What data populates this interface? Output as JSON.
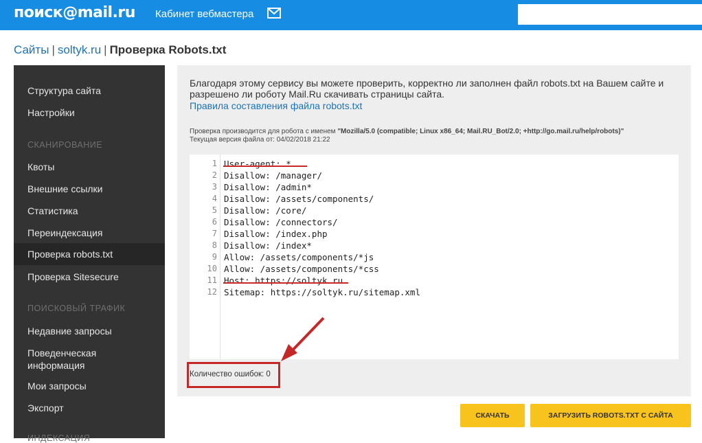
{
  "header": {
    "logo": "поиск@mail.ru",
    "cabinet_label": "Кабинет вебмастера",
    "mail_icon": "envelope-icon",
    "search_placeholder": ""
  },
  "breadcrumb": {
    "sites": "Сайты",
    "domain": "soltyk.ru",
    "current": "Проверка Robots.txt"
  },
  "sidebar": {
    "items_top": [
      "Структура сайта",
      "Настройки"
    ],
    "section_scanning": "СКАНИРОВАНИЕ",
    "items_scanning": [
      "Квоты",
      "Внешние ссылки",
      "Статистика",
      "Переиндексация",
      "Проверка robots.txt",
      "Проверка Sitesecure"
    ],
    "active_item": "Проверка robots.txt",
    "section_traffic": "ПОИСКОВЫЙ ТРАФИК",
    "items_traffic": [
      "Недавние запросы",
      "Поведенческая информация",
      "Мои запросы",
      "Экспорт"
    ],
    "section_cut": "ИНДЕКСАЦИЯ"
  },
  "main": {
    "intro": "Благодаря этому сервису вы можете проверить, корректно ли заполнен файл robots.txt на Вашем сайте и разрешено ли роботу Mail.Ru скачивать страницы сайта.",
    "rules_link": "Правила составления файла robots.txt",
    "check_prefix": "Проверка производится для робота с именем ",
    "robot_name": "\"Mozilla/5.0 (compatible; Linux x86_64; Mail.RU_Bot/2.0; +http://go.mail.ru/help/robots)\"",
    "version_label": "Текущая версия файла от: 04/02/2018 21:22",
    "code_lines": [
      "User-agent: *",
      "Disallow: /manager/",
      "Disallow: /admin*",
      "Disallow: /assets/components/",
      "Disallow: /core/",
      "Disallow: /connectors/",
      "Disallow: /index.php",
      "Disallow: /index*",
      "Allow: /assets/components/*js",
      "Allow: /assets/components/*css",
      "Host: https://soltyk.ru",
      "Sitemap: https://soltyk.ru/sitemap.xml"
    ],
    "errors_label": "Количество ошибок: 0"
  },
  "buttons": {
    "check": "СКАЧАТЬ",
    "upload": "ЗАГРУЗИТЬ ROBOTS.TXT С САЙТА"
  },
  "colors": {
    "header_blue": "#168de2",
    "sidebar_dark": "#333333",
    "accent_yellow": "#f7c31c",
    "annotation_red": "#c62828",
    "link_blue": "#1a73b8"
  }
}
